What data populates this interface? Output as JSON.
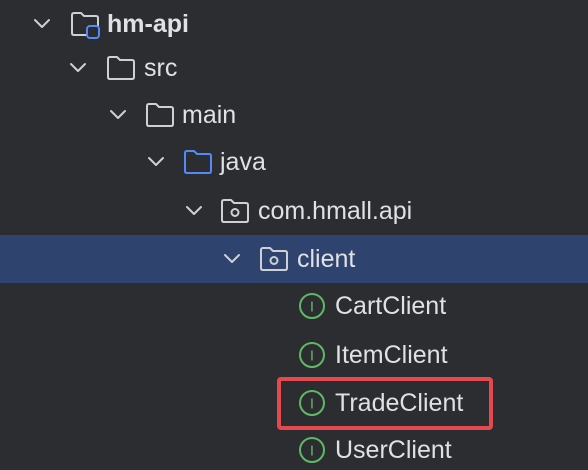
{
  "project_tree": {
    "nodes": [
      {
        "label": "hm-api",
        "icon": "module-folder-icon",
        "expanded": true
      },
      {
        "label": "src",
        "icon": "folder-icon",
        "expanded": true
      },
      {
        "label": "main",
        "icon": "folder-icon",
        "expanded": true
      },
      {
        "label": "java",
        "icon": "source-root-folder-icon",
        "expanded": true
      },
      {
        "label": "com.hmall.api",
        "icon": "package-icon",
        "expanded": true
      },
      {
        "label": "client",
        "icon": "package-icon",
        "expanded": true,
        "selected": true
      },
      {
        "label": "CartClient",
        "icon": "interface-icon"
      },
      {
        "label": "ItemClient",
        "icon": "interface-icon"
      },
      {
        "label": "TradeClient",
        "icon": "interface-icon",
        "highlighted": true
      },
      {
        "label": "UserClient",
        "icon": "interface-icon"
      }
    ],
    "interface_badge_letter": "I"
  },
  "colors": {
    "background": "#2b2d30",
    "selection": "#2e436e",
    "text": "#dfe1e5",
    "folder_stroke": "#ced0d6",
    "source_folder_stroke": "#548af7",
    "interface_green": "#5fb865",
    "highlight_border": "#e5484d"
  }
}
